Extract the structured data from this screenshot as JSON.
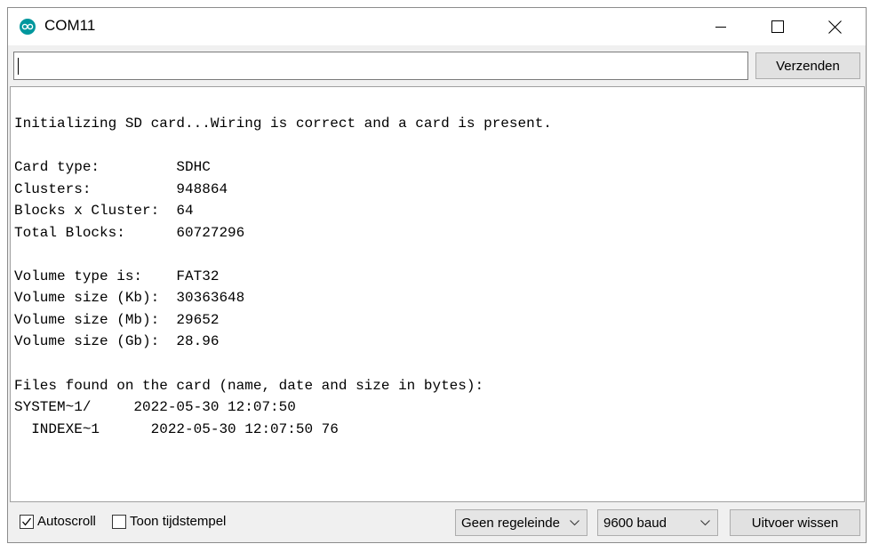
{
  "window": {
    "title": "COM11"
  },
  "toolbar": {
    "input_value": "",
    "send_label": "Verzenden"
  },
  "output": {
    "lines": [
      "",
      "Initializing SD card...Wiring is correct and a card is present.",
      "",
      "Card type:         SDHC",
      "Clusters:          948864",
      "Blocks x Cluster:  64",
      "Total Blocks:      60727296",
      "",
      "Volume type is:    FAT32",
      "Volume size (Kb):  30363648",
      "Volume size (Mb):  29652",
      "Volume size (Gb):  28.96",
      "",
      "Files found on the card (name, date and size in bytes):",
      "SYSTEM~1/     2022-05-30 12:07:50",
      "  INDEXE~1      2022-05-30 12:07:50 76"
    ]
  },
  "statusbar": {
    "autoscroll_label": "Autoscroll",
    "autoscroll_checked": true,
    "timestamp_label": "Toon tijdstempel",
    "timestamp_checked": false,
    "line_ending": "Geen regeleinde",
    "baud_rate": "9600 baud",
    "clear_label": "Uitvoer wissen"
  },
  "colors": {
    "app_icon": "#00979d",
    "chrome": "#f0f0f0",
    "button_face": "#e1e1e1"
  }
}
